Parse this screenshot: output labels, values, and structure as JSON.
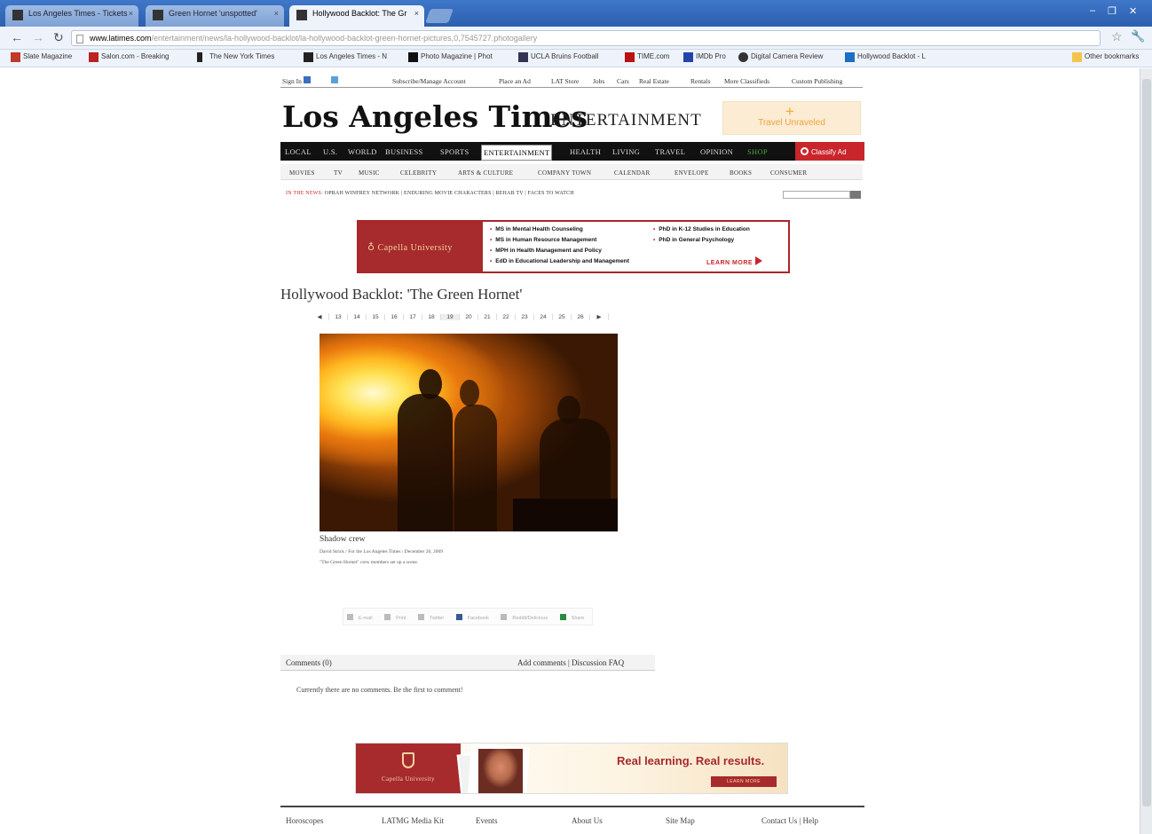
{
  "browser": {
    "tabs": [
      {
        "title": "Los Angeles Times - Tickets",
        "active": false
      },
      {
        "title": "Green Hornet 'unspotted'",
        "active": false
      },
      {
        "title": "Hollywood Backlot: The Gr",
        "active": true
      }
    ],
    "url_domain": "www.latimes.com",
    "url_rest": "/entertainment/news/la-hollywood-backlot/la-hollywood-backlot-green-hornet-pictures,0,7545727.photogallery",
    "bookmarks": [
      "Slate Magazine",
      "Salon.com - Breaking",
      "The New York Times",
      "Los Angeles Times - N",
      "Photo Magazine | Phot",
      "UCLA Bruins Football",
      "TIME.com",
      "IMDb Pro",
      "Digital Camera Review",
      "Hollywood Backlot - L"
    ],
    "other_bookmarks": "Other bookmarks"
  },
  "topnav": {
    "sign_in": "Sign In",
    "links": [
      "Subscribe/Manage Account",
      "Place an Ad",
      "LAT Store",
      "Jobs",
      "Cars",
      "Real Estate",
      "Rentals",
      "More Classifieds",
      "Custom Publishing"
    ]
  },
  "masthead": {
    "logo": "Los Angeles Times",
    "section": "ENTERTAINMENT",
    "ad_text": "Travel Unraveled"
  },
  "mainnav": {
    "items": [
      "LOCAL",
      "U.S.",
      "WORLD",
      "BUSINESS",
      "SPORTS",
      "ENTERTAINMENT",
      "HEALTH",
      "LIVING",
      "TRAVEL",
      "OPINION",
      "SHOP"
    ],
    "active": "ENTERTAINMENT",
    "classified": "Classify Ad"
  },
  "subnav": {
    "items": [
      "MOVIES",
      "TV",
      "MUSIC",
      "CELEBRITY",
      "ARTS & CULTURE",
      "COMPANY TOWN",
      "CALENDAR",
      "ENVELOPE",
      "BOOKS",
      "CONSUMER"
    ]
  },
  "trending": {
    "label": "IN THE NEWS:",
    "items": "OPRAH WINFREY NETWORK  |  ENDURING MOVIE CHARACTERS  |  REHAB TV  |  FACES TO WATCH"
  },
  "capella_ad": {
    "brand": "Capella University",
    "programs_left": [
      "MS in Mental Health Counseling",
      "MS in Human Resource Management",
      "MPH in Health Management and Policy",
      "EdD in Educational Leadership and Management"
    ],
    "programs_right": [
      "PhD in K-12 Studies in Education",
      "PhD in General Psychology"
    ],
    "cta": "LEARN MORE"
  },
  "gallery": {
    "title": "Hollywood Backlot: 'The Green Hornet'",
    "pager": [
      "◀",
      "13",
      "14",
      "15",
      "16",
      "17",
      "18",
      "19",
      "20",
      "21",
      "22",
      "23",
      "24",
      "25",
      "26",
      "▶"
    ],
    "caption_title": "Shadow crew",
    "caption_credit": "David Strick / For the Los Angeles Times / December 20, 2009",
    "caption_desc": "\"The Green Hornet\" crew members set up a scene."
  },
  "share": [
    "E-mail",
    "Print",
    "Twitter",
    "Facebook",
    "Reddit/Delicious",
    "Share"
  ],
  "comments": {
    "header": "Comments (0)",
    "links": "Add comments | Discussion FAQ",
    "empty": "Currently there are no comments. Be the first to comment!"
  },
  "bottom_ad": {
    "brand": "Capella University",
    "headline": "Real learning. Real results.",
    "cta": "LEARN MORE"
  },
  "footer": [
    "Horoscopes",
    "LATMG Media Kit",
    "Events",
    "About Us",
    "Site Map",
    "Contact Us | Help"
  ]
}
